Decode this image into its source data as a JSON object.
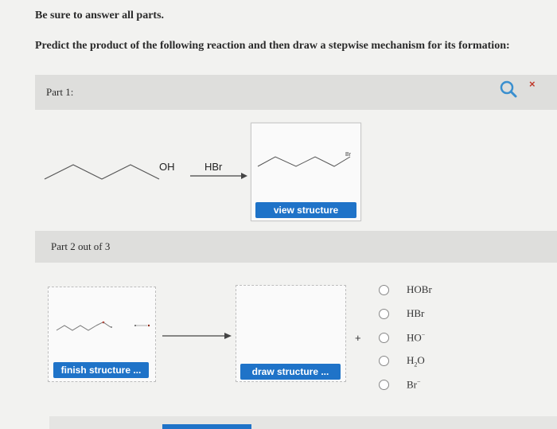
{
  "instructions": {
    "line1": "Be sure to answer all parts.",
    "line2": "Predict the product of the following reaction and then draw a stepwise mechanism for its formation:"
  },
  "part1": {
    "label": "Part 1:",
    "close": "×",
    "reactant_group": "OH",
    "reagent": "HBr",
    "product_group": "Br",
    "view_button": "view structure"
  },
  "part2": {
    "label": "Part 2 out of 3",
    "finish_button": "finish structure ...",
    "draw_button": "draw structure ...",
    "plus": "+",
    "options": [
      {
        "formula": "HOBr"
      },
      {
        "formula": "HBr"
      },
      {
        "formula": "HO",
        "sup": "−"
      },
      {
        "formula": "H",
        "sub": "2",
        "tail": "O"
      },
      {
        "formula": "Br",
        "sup": "−"
      }
    ]
  },
  "colors": {
    "accent": "#1f73c8",
    "close": "#c0392b",
    "bar": "#dededc"
  },
  "icons": [
    "search-icon",
    "close-icon",
    "radio-icon",
    "reaction-arrow-icon"
  ]
}
